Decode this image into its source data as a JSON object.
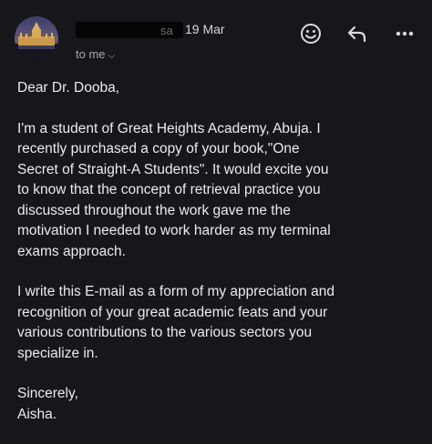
{
  "header": {
    "sender_name": "sa",
    "date": "19 Mar",
    "recipient": "to me",
    "icons": {
      "emoji": "smiley-face-icon",
      "reply": "reply-arrow-icon",
      "more": "more-horizontal-icon"
    }
  },
  "email": {
    "greeting": "Dear Dr. Dooba,",
    "paragraph_1": "I'm a student of Great Heights Academy, Abuja. I\n recently purchased a copy of your book,\"One\nSecret of Straight-A Students\". It would excite you\nto know that the concept of retrieval practice you\ndiscussed throughout the work gave me the\nmotivation I needed to work harder as my terminal\nexams approach.",
    "paragraph_2": "I write this E-mail as a form of my appreciation and\nrecognition of your great academic feats and your\nvarious contributions to the various sectors you\nspecialize in.",
    "closing": "Sincerely,\nAisha."
  },
  "colors": {
    "background": "#16171b",
    "text": "#ebebee",
    "muted": "#a9aaaf"
  }
}
